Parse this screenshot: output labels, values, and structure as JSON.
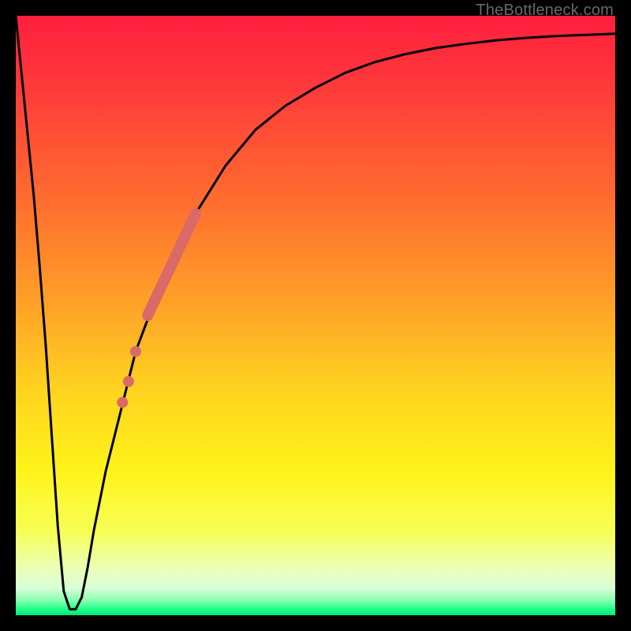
{
  "watermark": "TheBottleneck.com",
  "colors": {
    "frame": "#000000",
    "curve": "#000000",
    "marker": "#d96a67",
    "gradient_stops": [
      {
        "offset": 0.0,
        "color": "#ff1f3e"
      },
      {
        "offset": 0.12,
        "color": "#ff3a3a"
      },
      {
        "offset": 0.3,
        "color": "#ff6a2f"
      },
      {
        "offset": 0.48,
        "color": "#ffa127"
      },
      {
        "offset": 0.62,
        "color": "#ffd21f"
      },
      {
        "offset": 0.76,
        "color": "#fff31a"
      },
      {
        "offset": 0.86,
        "color": "#f7ff55"
      },
      {
        "offset": 0.92,
        "color": "#ecffb4"
      },
      {
        "offset": 0.955,
        "color": "#d8ffd8"
      },
      {
        "offset": 0.975,
        "color": "#8affb0"
      },
      {
        "offset": 0.99,
        "color": "#1eff8a"
      },
      {
        "offset": 1.0,
        "color": "#00e874"
      }
    ]
  },
  "chart_data": {
    "type": "line",
    "title": "",
    "xlabel": "",
    "ylabel": "",
    "xlim": [
      0,
      100
    ],
    "ylim": [
      0,
      100
    ],
    "grid": false,
    "series": [
      {
        "name": "bottleneck-curve",
        "x": [
          0,
          1,
          2,
          3,
          4,
          5,
          6,
          7,
          8,
          9,
          10,
          11,
          12,
          13,
          15,
          18,
          20,
          23,
          26,
          30,
          35,
          40,
          45,
          50,
          55,
          60,
          65,
          70,
          75,
          80,
          85,
          90,
          95,
          100
        ],
        "y": [
          100,
          90,
          80,
          70,
          58,
          45,
          30,
          15,
          4,
          1,
          1,
          3,
          8,
          14,
          24,
          36,
          44,
          52,
          59,
          67,
          75,
          81,
          85,
          88,
          90.5,
          92.3,
          93.6,
          94.6,
          95.3,
          95.9,
          96.3,
          96.6,
          96.8,
          97
        ]
      }
    ],
    "markers": {
      "name": "highlighted-segment",
      "type": "scatter",
      "color": "#d96a67",
      "segment_start": {
        "x": 22,
        "y": 50
      },
      "segment_end": {
        "x": 30,
        "y": 67
      },
      "dots": [
        {
          "x": 20.0,
          "y": 44
        },
        {
          "x": 18.8,
          "y": 39
        },
        {
          "x": 17.8,
          "y": 35.5
        }
      ]
    }
  }
}
